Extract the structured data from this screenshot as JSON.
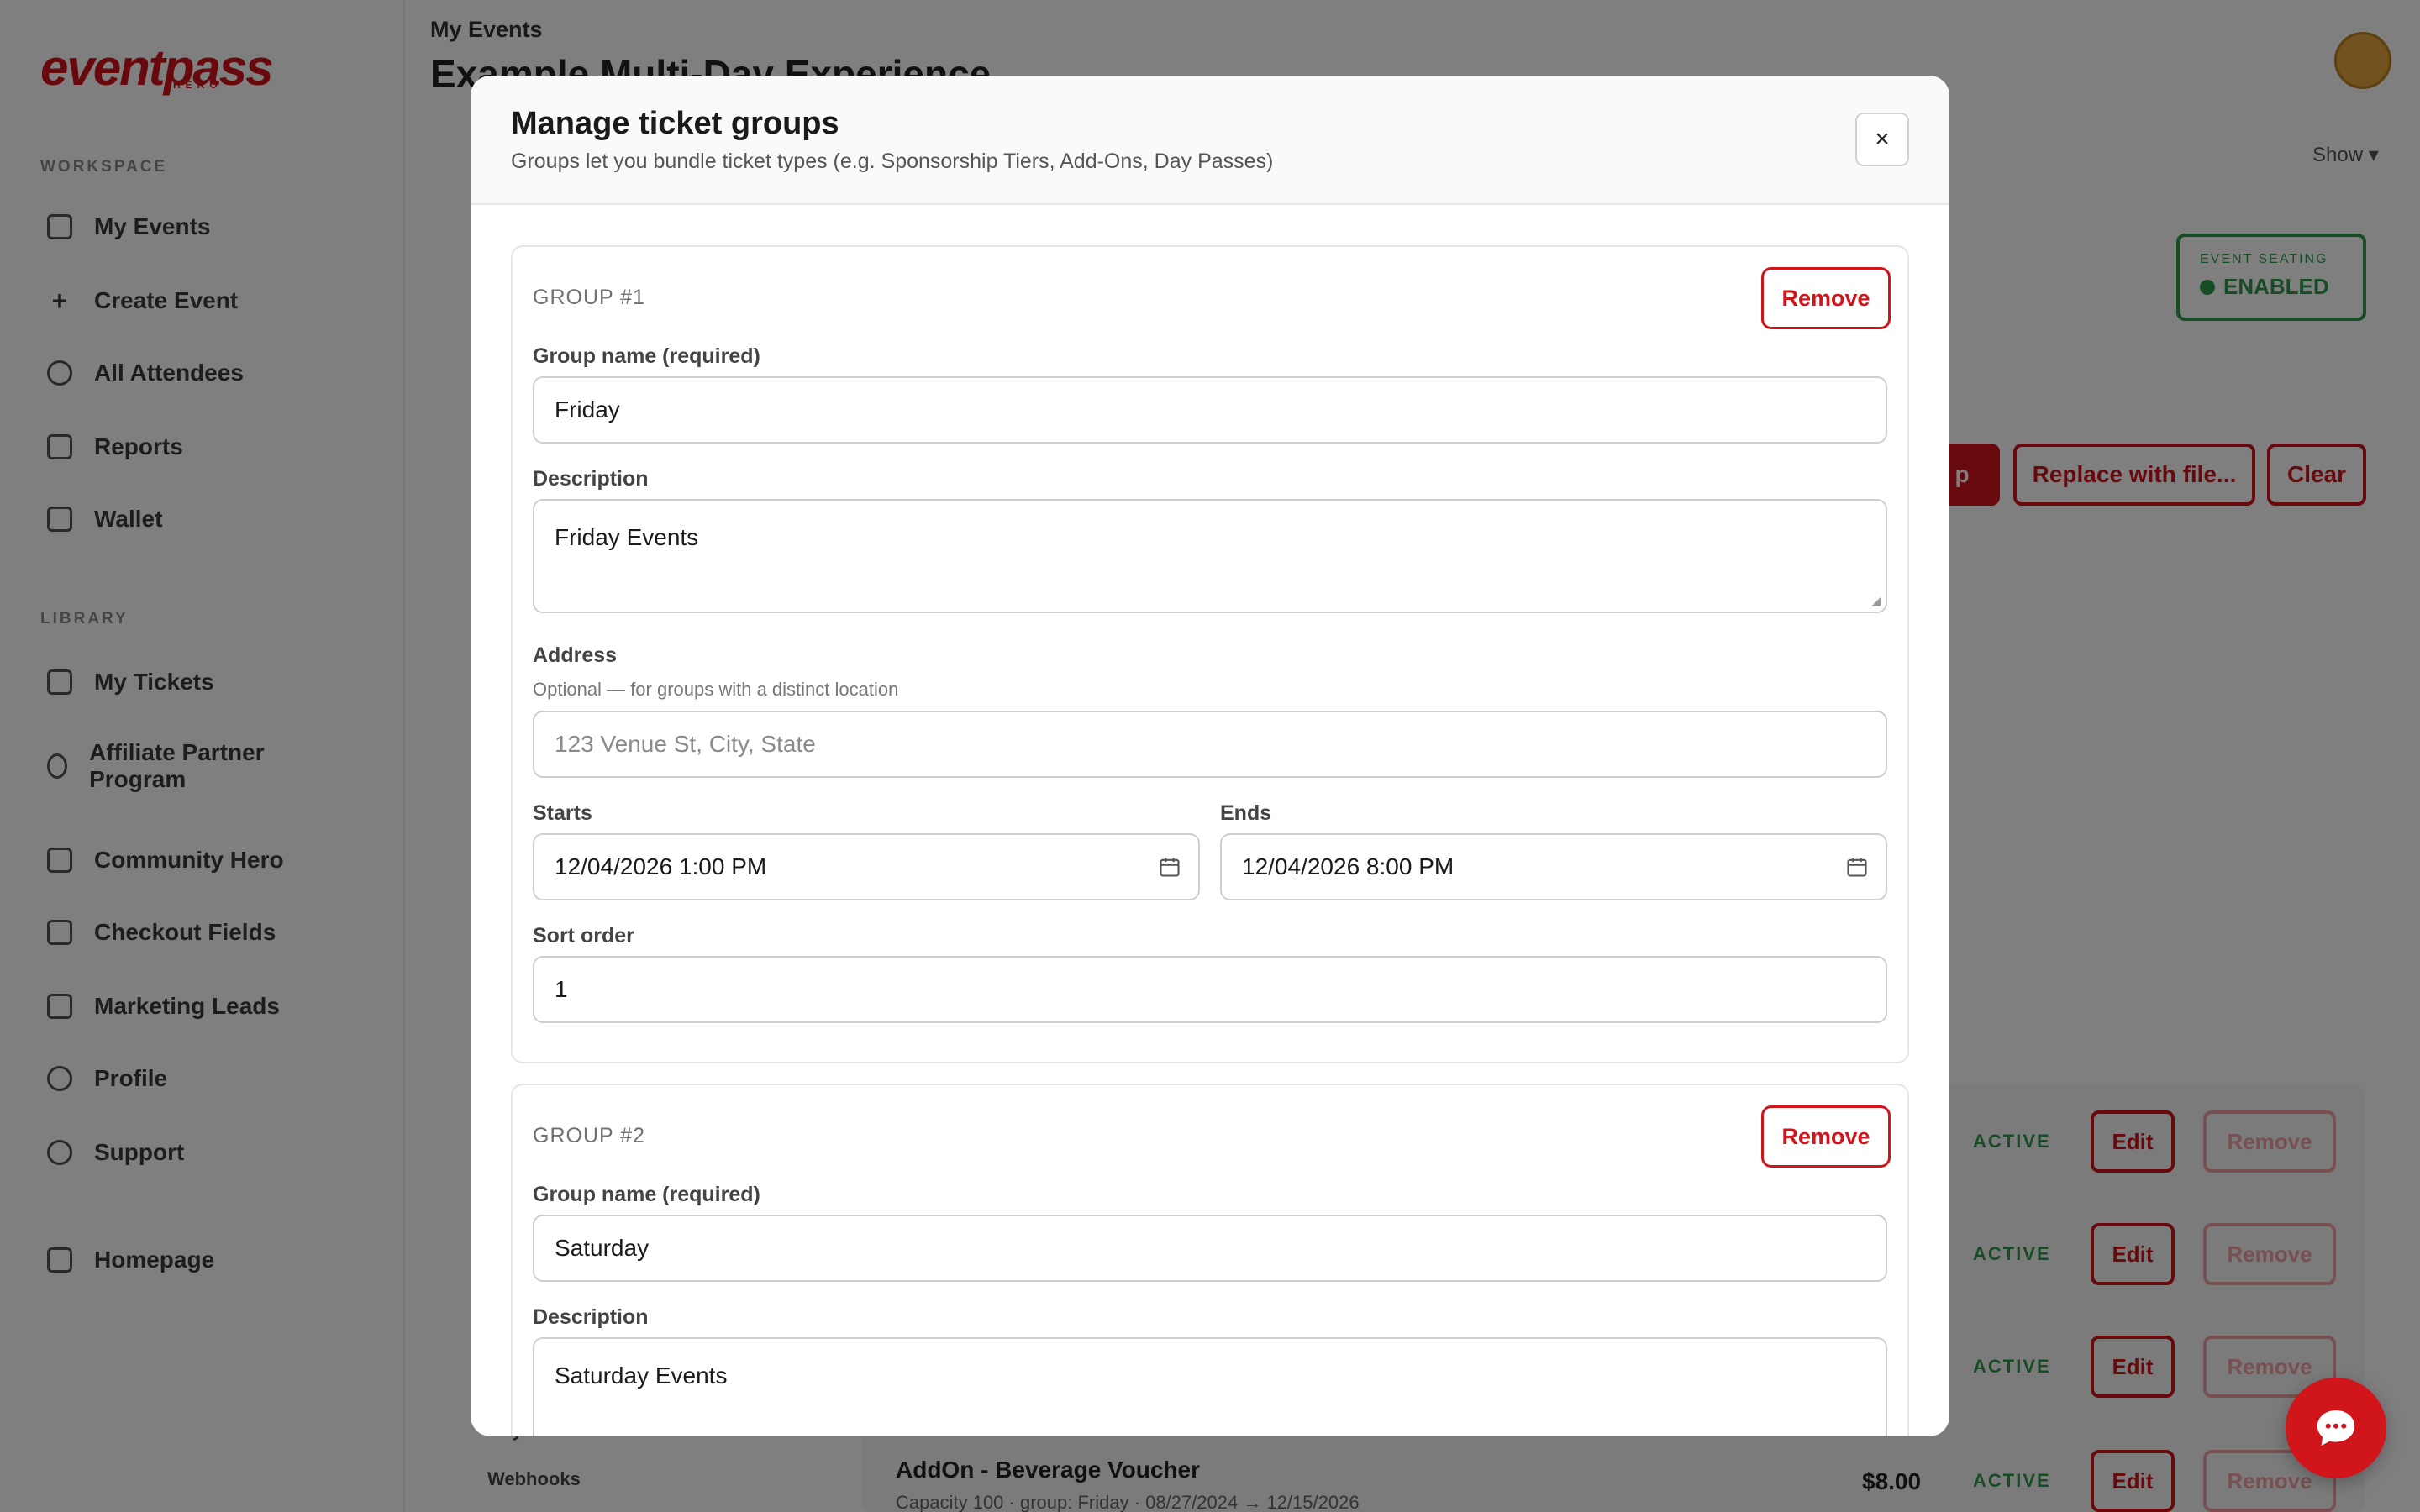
{
  "app": {
    "logo_main": "eventpass",
    "logo_sub": "HERO",
    "breadcrumb": "My Events",
    "page_title": "Example Multi-Day Experience",
    "show_label": "Show",
    "seating_badge": {
      "label": "EVENT SEATING",
      "value": "ENABLED"
    },
    "sidebar": {
      "workspace_label": "WORKSPACE",
      "workspace_items": [
        "My Events",
        "Create Event",
        "All Attendees",
        "Reports",
        "Wallet"
      ],
      "library_label": "LIBRARY",
      "library_items": [
        "My Tickets",
        "Affiliate Partner Program",
        "Community Hero",
        "Checkout Fields",
        "Marketing Leads",
        "Profile",
        "Support"
      ],
      "homepage_label": "Homepage"
    },
    "toolbar": {
      "replace_label": "Replace with file...",
      "clear_label": "Clear",
      "primary_label": "p"
    },
    "ticket_rows": [
      {
        "status": "ACTIVE",
        "edit": "Edit",
        "remove": "Remove"
      },
      {
        "status": "ACTIVE",
        "edit": "Edit",
        "remove": "Remove"
      },
      {
        "status": "ACTIVE",
        "edit": "Edit",
        "remove": "Remove"
      },
      {
        "name": "AddOn - Beverage Voucher",
        "sub": "Capacity 100 · group: Friday · 08/27/2024 → 12/15/2026",
        "price": "$8.00",
        "status": "ACTIVE",
        "edit": "Edit",
        "remove": "Remove"
      }
    ],
    "sub_nav": [
      "Buyer Restrictions",
      "Webhooks"
    ]
  },
  "modal": {
    "title": "Manage ticket groups",
    "subtitle": "Groups let you bundle ticket types (e.g. Sponsorship Tiers, Add-Ons, Day Passes)",
    "close_label": "×",
    "groups": [
      {
        "label": "GROUP #1",
        "remove_label": "Remove",
        "name_label": "Group name (required)",
        "name_value": "Friday",
        "description_label": "Description",
        "description_value": "Friday Events",
        "address_label": "Address",
        "address_hint": "Optional — for groups with a distinct location",
        "address_placeholder": "123 Venue St, City, State",
        "starts_label": "Starts",
        "starts_value": "12/04/2026 1:00 PM",
        "ends_label": "Ends",
        "ends_value": "12/04/2026 8:00 PM",
        "sort_label": "Sort order",
        "sort_value": "1"
      },
      {
        "label": "GROUP #2",
        "remove_label": "Remove",
        "name_label": "Group name (required)",
        "name_value": "Saturday",
        "description_label": "Description",
        "description_value": "Saturday Events"
      }
    ]
  },
  "colors": {
    "brand": "#d0151b",
    "success": "#2c9b4a",
    "overlay": "rgba(0,0,0,0.5)"
  }
}
